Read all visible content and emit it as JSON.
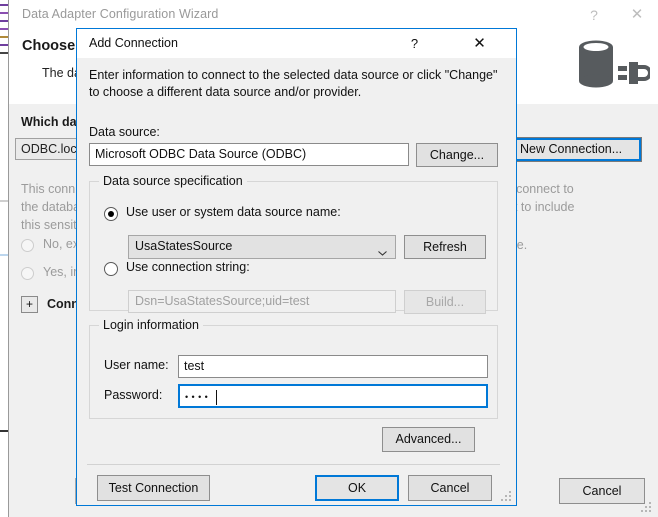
{
  "background_window": {
    "title": "Data Adapter Configuration Wizard",
    "help_icon": "question-mark-icon",
    "close_icon": "close-icon",
    "heading": "Choose Y",
    "subheading": "The dat",
    "db_icon": "database-connection-icon",
    "which_label": "Which dat",
    "connection_value": "ODBC.loca",
    "new_connection_label": "New Connection...",
    "info_lines": [
      "This conn",
      "the databa",
      "this sensiti"
    ],
    "info_right_lines": [
      "equired to connect to",
      "o you want to include",
      "ication code."
    ],
    "radio_no_label": "No, exc",
    "radio_yes_label": "Yes, inc",
    "expander_glyph": "+",
    "expander_label": "Conne",
    "cancel_label": "Cancel",
    "grip_icon": "resize-grip-icon"
  },
  "dialog": {
    "title": "Add Connection",
    "help_icon": "question-mark-icon",
    "close_icon": "close-icon",
    "intro": "Enter information to connect to the selected data source or click \"Change\" to choose a different data source and/or provider.",
    "data_source_label": "Data source:",
    "data_source_value": "Microsoft ODBC Data Source (ODBC)",
    "change_button": "Change...",
    "spec_group": {
      "legend": "Data source specification",
      "radio_dsn_label": "Use user or system data source name:",
      "radio_dsn_selected": true,
      "dsn_combo_value": "UsaStatesSource",
      "dsn_combo_arrow": "chevron-down-icon",
      "refresh_button": "Refresh",
      "radio_connstr_label": "Use connection string:",
      "radio_connstr_selected": false,
      "connstr_value": "Dsn=UsaStatesSource;uid=test",
      "build_button": "Build..."
    },
    "login_group": {
      "legend": "Login information",
      "user_label": "User name:",
      "user_value": "test",
      "password_label": "Password:",
      "password_value": "••••"
    },
    "advanced_button": "Advanced...",
    "test_connection_button": "Test Connection",
    "ok_button": "OK",
    "cancel_button": "Cancel",
    "grip_icon": "resize-grip-icon"
  },
  "colors": {
    "accent": "#0078d7",
    "dialog_bg": "#f0f0f0",
    "window_bg": "#ffffff",
    "disabled_text": "#a0a0a0",
    "inactive_title": "#999999"
  }
}
